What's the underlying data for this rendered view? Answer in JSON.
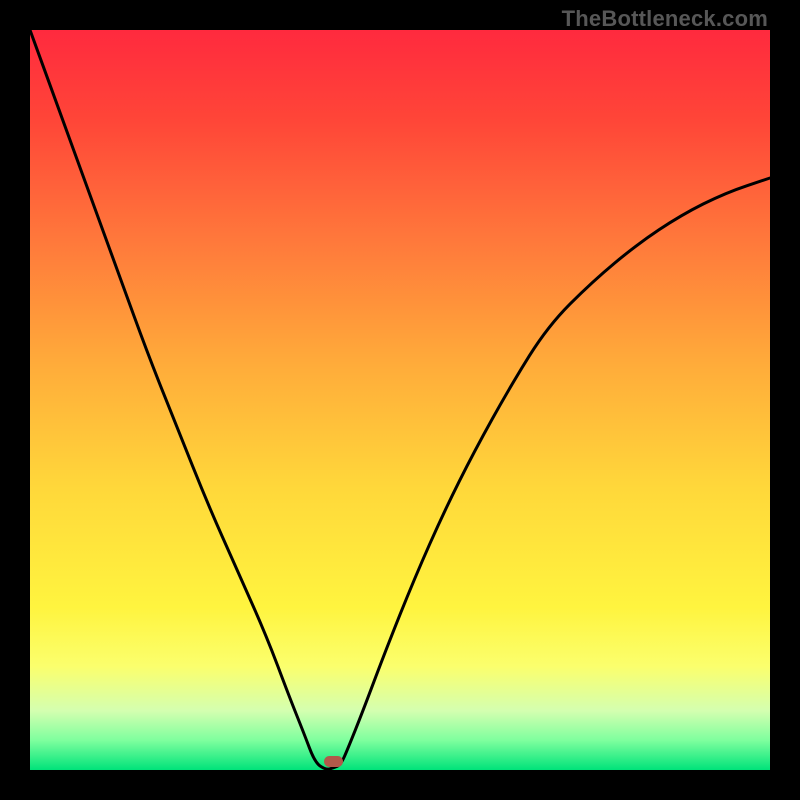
{
  "watermark": "TheBottleneck.com",
  "chart_data": {
    "type": "line",
    "title": "",
    "xlabel": "",
    "ylabel": "",
    "xlim": [
      0,
      100
    ],
    "ylim": [
      0,
      100
    ],
    "grid": false,
    "legend": false,
    "background_gradient_stops": [
      {
        "pct": 0,
        "color": "#ff2a3e"
      },
      {
        "pct": 12,
        "color": "#ff4538"
      },
      {
        "pct": 28,
        "color": "#ff773b"
      },
      {
        "pct": 45,
        "color": "#ffab3a"
      },
      {
        "pct": 62,
        "color": "#ffd83a"
      },
      {
        "pct": 78,
        "color": "#fff43f"
      },
      {
        "pct": 86,
        "color": "#fbff6d"
      },
      {
        "pct": 92,
        "color": "#d4ffb0"
      },
      {
        "pct": 96,
        "color": "#7eff9e"
      },
      {
        "pct": 100,
        "color": "#00e37a"
      }
    ],
    "series": [
      {
        "name": "curve",
        "x": [
          0,
          4,
          8,
          12,
          16,
          20,
          24,
          28,
          32,
          35,
          37,
          38.5,
          40,
          41,
          42,
          43,
          45,
          48,
          52,
          56,
          60,
          65,
          70,
          76,
          82,
          88,
          94,
          100
        ],
        "y": [
          100,
          89,
          78,
          67,
          56,
          46,
          36,
          27,
          18,
          10,
          5,
          1,
          0,
          0.3,
          0.7,
          3,
          8,
          16,
          26,
          35,
          43,
          52,
          60,
          66,
          71,
          75,
          78,
          80
        ]
      }
    ],
    "marker": {
      "x": 40.5,
      "y": 0,
      "color": "#b0594a"
    }
  }
}
